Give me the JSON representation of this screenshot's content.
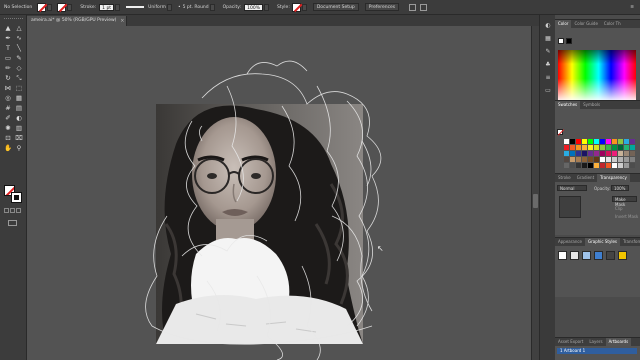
{
  "control_bar": {
    "selection": "No Selection",
    "stroke_label": "Stroke:",
    "stroke_weight": "1 pt",
    "profile": "Uniform",
    "brush": "5 pt. Round",
    "opacity_label": "Opacity:",
    "opacity_value": "100%",
    "style_label": "Style:",
    "document_setup": "Document Setup",
    "preferences": "Preferences"
  },
  "document": {
    "tab_title": "ameira.ai* @ 50% (RGB/GPU Preview)",
    "close_glyph": "×"
  },
  "tools": [
    {
      "name": "selection-tool",
      "glyph": "▲"
    },
    {
      "name": "direct-selection-tool",
      "glyph": "△"
    },
    {
      "name": "pen-tool",
      "glyph": "✒"
    },
    {
      "name": "curvature-tool",
      "glyph": "∿"
    },
    {
      "name": "type-tool",
      "glyph": "T"
    },
    {
      "name": "line-segment-tool",
      "glyph": "╲"
    },
    {
      "name": "rectangle-tool",
      "glyph": "▭"
    },
    {
      "name": "paintbrush-tool",
      "glyph": "✎"
    },
    {
      "name": "pencil-tool",
      "glyph": "✏"
    },
    {
      "name": "eraser-tool",
      "glyph": "◇"
    },
    {
      "name": "rotate-tool",
      "glyph": "↻"
    },
    {
      "name": "scale-tool",
      "glyph": "⤡"
    },
    {
      "name": "width-tool",
      "glyph": "⋈"
    },
    {
      "name": "free-transform-tool",
      "glyph": "⬚"
    },
    {
      "name": "shape-builder-tool",
      "glyph": "◎"
    },
    {
      "name": "perspective-grid-tool",
      "glyph": "▦"
    },
    {
      "name": "mesh-tool",
      "glyph": "#"
    },
    {
      "name": "gradient-tool",
      "glyph": "▤"
    },
    {
      "name": "eyedropper-tool",
      "glyph": "✐"
    },
    {
      "name": "blend-tool",
      "glyph": "◐"
    },
    {
      "name": "symbol-sprayer-tool",
      "glyph": "✺"
    },
    {
      "name": "column-graph-tool",
      "glyph": "▥"
    },
    {
      "name": "artboard-tool",
      "glyph": "⊡"
    },
    {
      "name": "slice-tool",
      "glyph": "⌧"
    },
    {
      "name": "hand-tool",
      "glyph": "✋"
    },
    {
      "name": "zoom-tool",
      "glyph": "⚲"
    }
  ],
  "dock_icons": [
    {
      "name": "color-panel-icon",
      "glyph": "◐"
    },
    {
      "name": "swatches-panel-icon",
      "glyph": "▦"
    },
    {
      "name": "brushes-panel-icon",
      "glyph": "✎"
    },
    {
      "name": "symbols-panel-icon",
      "glyph": "♣"
    },
    {
      "name": "stroke-panel-icon",
      "glyph": "≡"
    },
    {
      "name": "gradient-panel-icon",
      "glyph": "▭"
    }
  ],
  "color_panel": {
    "tabs": [
      "Color",
      "Color Guide",
      "Color Th"
    ],
    "accent": "#ff0000"
  },
  "swatches_panel": {
    "tabs": [
      "Swatches",
      "Symbols"
    ],
    "colors": [
      "#ffffff",
      "#000000",
      "#ff0000",
      "#ffff00",
      "#00ff00",
      "#00ffff",
      "#0000ff",
      "#ff00ff",
      "#f7931e",
      "#8cc63f",
      "#29abe2",
      "#662d91",
      "#ed1c24",
      "#f15a24",
      "#f7931e",
      "#fbb03b",
      "#fcee21",
      "#d9e021",
      "#8cc63f",
      "#39b54a",
      "#009245",
      "#006837",
      "#22b573",
      "#00a99d",
      "#29abe2",
      "#0071bc",
      "#2e3192",
      "#1b1464",
      "#662d91",
      "#93278f",
      "#9e005d",
      "#d4145a",
      "#ed1e79",
      "#c7b299",
      "#998675",
      "#736357",
      "#534741",
      "#c69c6d",
      "#a67c52",
      "#8c6239",
      "#754c24",
      "#603813",
      "#ffffff",
      "#e6e6e6",
      "#cccccc",
      "#b3b3b3",
      "#999999",
      "#808080",
      "#666666",
      "#4d4d4d",
      "#333333",
      "#1a1a1a",
      "#000000",
      "#fbb03b",
      "#c1272d",
      "#f15a24",
      "#ffffff",
      "#cccccc",
      "#999999",
      "#4d4d4d"
    ]
  },
  "transparency_panel": {
    "tabs": [
      "Stroke",
      "Gradient",
      "Transparency"
    ],
    "blend_mode": "Normal",
    "opacity_label": "Opacity:",
    "opacity_value": "100%",
    "make_mask": "Make Mask",
    "clip": "Clip",
    "invert_mask": "Invert Mask"
  },
  "graphic_styles_panel": {
    "tabs": [
      "Appearance",
      "Graphic Styles",
      "Transform"
    ],
    "styles": [
      "#ffffff",
      "#e6e6e6",
      "#9fc3ea",
      "#3f7fd0",
      "#444444",
      "#f2c500"
    ]
  },
  "artboards_panel": {
    "tabs": [
      "Asset Export",
      "Layers",
      "Artboards"
    ],
    "rows": [
      "1   Artboard 1"
    ]
  }
}
